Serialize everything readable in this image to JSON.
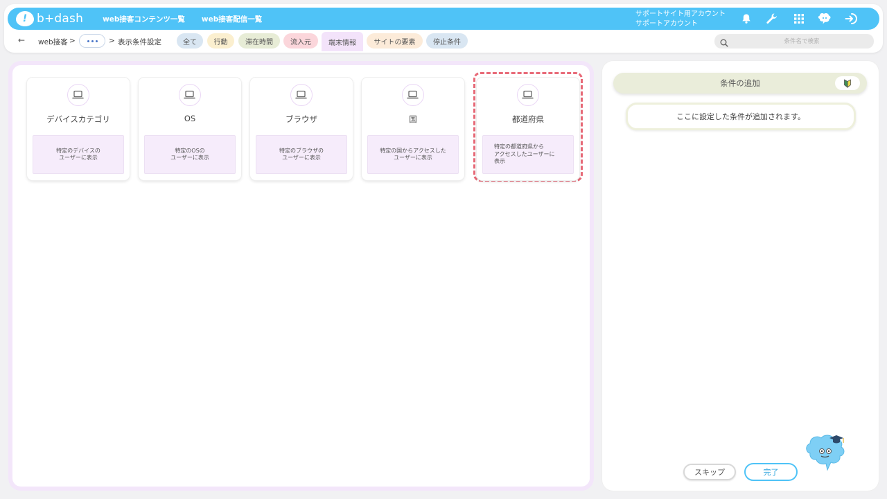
{
  "header": {
    "logo_text": "b+dash",
    "nav_links": [
      "web接客コンテンツ一覧",
      "web接客配信一覧"
    ],
    "account_line1": "サポートサイト用アカウント",
    "account_line2": "サポートアカウント",
    "icons": [
      "bell-icon",
      "wrench-icon",
      "grid-icon",
      "mascot-face-icon",
      "logout-icon"
    ],
    "brand_color": "#4fc3f7"
  },
  "breadcrumb": {
    "back_symbol": "←",
    "web_label": "web接客",
    "sep1": ">",
    "sep2": ">",
    "current": "表示条件設定"
  },
  "filter_tabs": [
    {
      "label": "全て",
      "color": "#d9e6f2"
    },
    {
      "label": "行動",
      "color": "#fbefcf"
    },
    {
      "label": "滞在時間",
      "color": "#e7ecd6"
    },
    {
      "label": "流入元",
      "color": "#fbd6db"
    },
    {
      "label": "端末情報",
      "color": "#f3e3fa"
    },
    {
      "label": "サイトの要素",
      "color": "#fcebd9"
    },
    {
      "label": "停止条件",
      "color": "#d9e6f2"
    }
  ],
  "active_tab": "端末情報",
  "search": {
    "placeholder": "条件名で検索"
  },
  "condition_cards": [
    {
      "title": "デバイスカテゴリ",
      "description": "特定のデバイスの\nユーザーに表示",
      "icon": "laptop-icon"
    },
    {
      "title": "OS",
      "description": "特定のOSの\nユーザーに表示",
      "icon": "laptop-icon"
    },
    {
      "title": "ブラウザ",
      "description": "特定のブラウザの\nユーザーに表示",
      "icon": "laptop-icon"
    },
    {
      "title": "国",
      "description": "特定の国からアクセスした\nユーザーに表示",
      "icon": "laptop-icon"
    },
    {
      "title": "都道府県",
      "description": "特定の都道府県から\nアクセスしたユーザーに\n表示",
      "icon": "laptop-icon"
    }
  ],
  "selected_card": "都道府県",
  "right_panel": {
    "header": "条件の追加",
    "placeholder": "ここに設定した条件が追加されます。",
    "skip_label": "スキップ",
    "done_label": "完了"
  }
}
